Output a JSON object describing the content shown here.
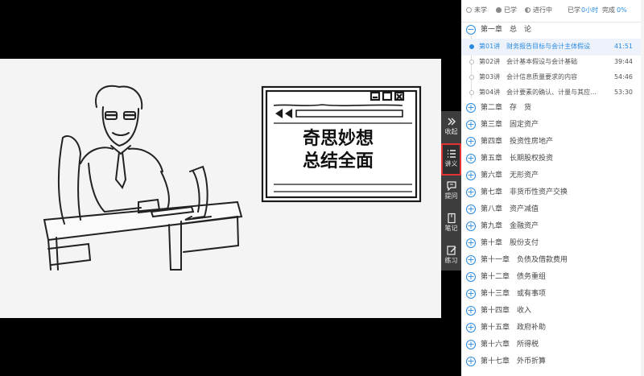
{
  "legend": {
    "not_learned": "未学",
    "learned": "已学",
    "in_progress": "进行中",
    "learned_hours_label": "已学",
    "learned_hours_value": "0小时",
    "completion_label": "完成",
    "completion_value": "0%"
  },
  "video": {
    "overlay_line1": "奇思妙想",
    "overlay_line2": "总结全面"
  },
  "tools": [
    {
      "label": "收起",
      "icon": "collapse-icon"
    },
    {
      "label": "讲义",
      "icon": "list-icon"
    },
    {
      "label": "提问",
      "icon": "question-icon"
    },
    {
      "label": "笔记",
      "icon": "note-icon"
    },
    {
      "label": "练习",
      "icon": "exercise-icon"
    }
  ],
  "chapter1": {
    "title": "第一章　总　论",
    "lessons": [
      {
        "title": "第01讲　财务报告目标与会计主体假设",
        "duration": "41:51"
      },
      {
        "title": "第02讲　会计基本假设与会计基础",
        "duration": "39:44"
      },
      {
        "title": "第03讲　会计信息质量要求的内容",
        "duration": "54:46"
      },
      {
        "title": "第04讲　会计要素的确认、计量与其应...",
        "duration": "53:30"
      }
    ]
  },
  "chapters": [
    "第二章　存　货",
    "第三章　固定资产",
    "第四章　投资性房地产",
    "第五章　长期股权投资",
    "第六章　无形资产",
    "第七章　非货币性资产交换",
    "第八章　资产减值",
    "第九章　金融资产",
    "第十章　股份支付",
    "第十一章　负债及借款费用",
    "第十二章　债务重组",
    "第十三章　或有事项",
    "第十四章　收入",
    "第十五章　政府补助",
    "第十六章　所得税",
    "第十七章　外币折算"
  ],
  "colors": {
    "accent": "#2a8ae0",
    "active_outline": "#e03434",
    "toolbar_bg": "#3d3d3d"
  }
}
